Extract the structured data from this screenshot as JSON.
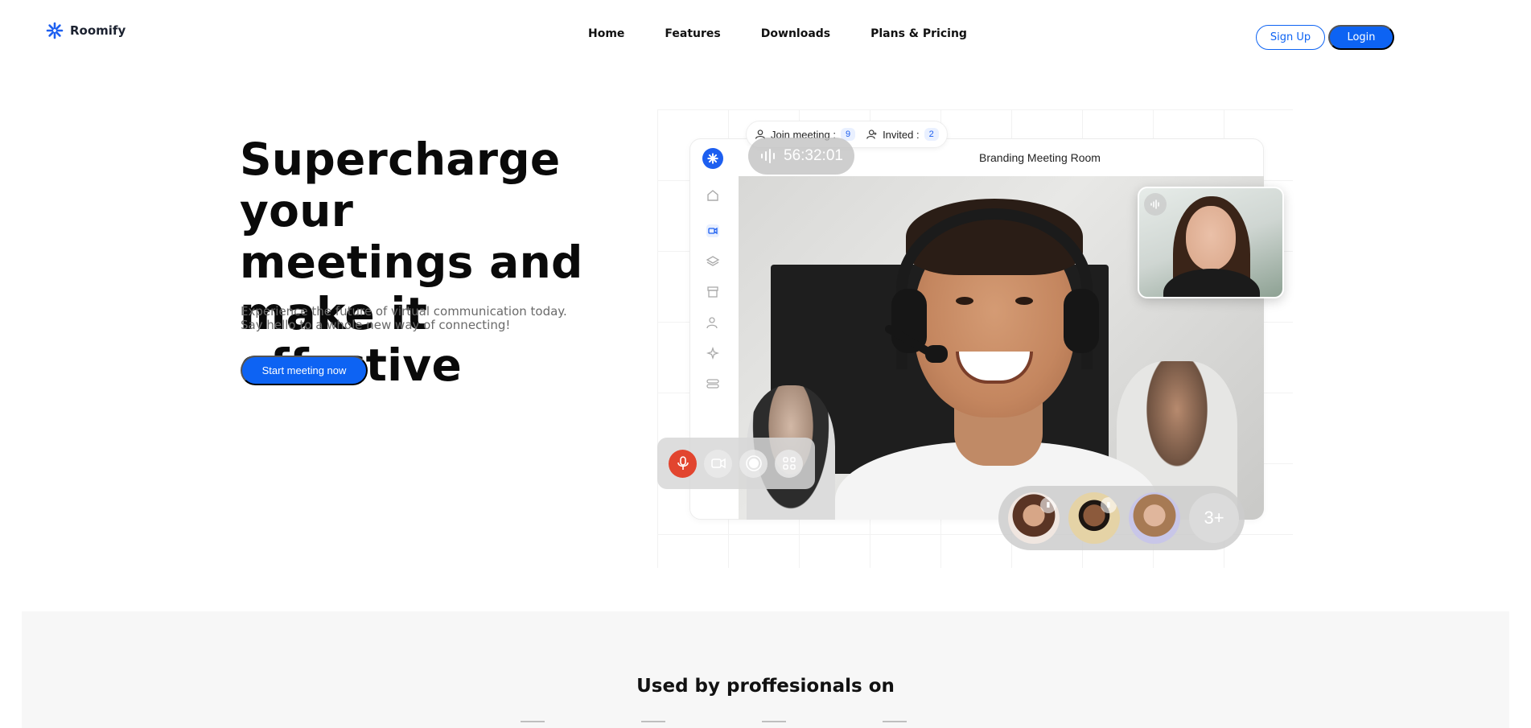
{
  "brand": {
    "name": "Roomify"
  },
  "nav": {
    "links": [
      "Home",
      "Features",
      "Downloads",
      "Plans & Pricing"
    ],
    "signup_label": "Sign Up",
    "login_label": "Login"
  },
  "hero": {
    "title_lines": [
      "Supercharge your",
      "meetings and",
      "make it effective"
    ],
    "subtitle_lines": [
      "Experience the future of virtual communication today.",
      "Say hello to a whole new way of connecting!"
    ],
    "cta_label": "Start meeting now"
  },
  "mockup": {
    "join_label": "Join meeting :",
    "join_count": "9",
    "invited_label": "Invited :",
    "invited_count": "2",
    "room_title": "Branding Meeting Room",
    "timer": "56:32:01",
    "more_participants": "3+"
  },
  "used_by": {
    "title": "Used by proffesionals on"
  },
  "colors": {
    "accent": "#0d63f3",
    "mic_active": "#e2452f",
    "section_bg": "#f7f7f7"
  }
}
